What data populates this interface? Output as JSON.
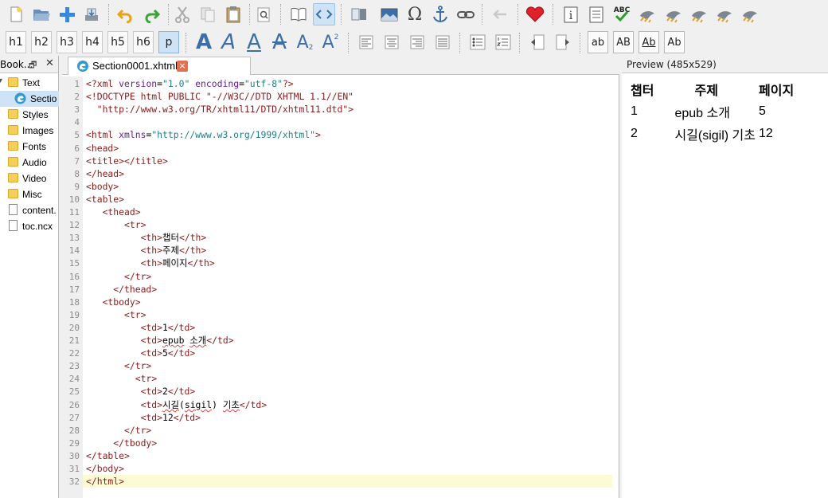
{
  "toolbar_row1": {
    "icons": [
      "new-file-icon",
      "open-folder-icon",
      "add-file-icon",
      "save-icon",
      "undo-icon",
      "redo-icon",
      "cut-icon",
      "copy-icon",
      "paste-icon",
      "find-icon",
      "book-view-icon",
      "code-view-icon",
      "split-view-icon",
      "insert-image-icon",
      "special-char-icon",
      "anchor-icon",
      "link-icon",
      "back-icon",
      "validate-icon",
      "metadata-icon",
      "toc-icon",
      "spellcheck-icon",
      "plugin-1-icon",
      "plugin-2-icon",
      "plugin-3-icon",
      "plugin-4-icon",
      "plugin-5-icon"
    ]
  },
  "toolbar_row2": {
    "headings": [
      "h1",
      "h2",
      "h3",
      "h4",
      "h5",
      "h6",
      "p"
    ],
    "active_heading": "p",
    "case_buttons": [
      "ab",
      "AB",
      "Ab",
      "Ab"
    ]
  },
  "book_browser": {
    "title": "Book...",
    "float_glyph": "🗗",
    "close_glyph": "✕",
    "items": [
      {
        "label": "Text",
        "kind": "folder"
      },
      {
        "label": "Sectio",
        "kind": "edge"
      },
      {
        "label": "Styles",
        "kind": "folder"
      },
      {
        "label": "Images",
        "kind": "folder"
      },
      {
        "label": "Fonts",
        "kind": "folder"
      },
      {
        "label": "Audio",
        "kind": "folder"
      },
      {
        "label": "Video",
        "kind": "folder"
      },
      {
        "label": "Misc",
        "kind": "folder"
      },
      {
        "label": "content.",
        "kind": "file"
      },
      {
        "label": "toc.ncx",
        "kind": "file"
      }
    ]
  },
  "editor": {
    "tab_label": "Section0001.xhtml",
    "tab_close": "×",
    "current_line": 32,
    "lines": [
      [
        [
          "pi",
          "<?xml "
        ],
        [
          "at",
          "version"
        ],
        [
          "tx",
          "="
        ],
        [
          "st",
          "\"1.0\""
        ],
        [
          "tx",
          " "
        ],
        [
          "at",
          "encoding"
        ],
        [
          "tx",
          "="
        ],
        [
          "st",
          "\"utf-8\""
        ],
        [
          "pi",
          "?>"
        ]
      ],
      [
        [
          "tg",
          "<!DOCTYPE html PUBLIC \"-//W3C//DTD XHTML 1.1//EN\""
        ]
      ],
      [
        [
          "tg",
          "  \"http://www.w3.org/TR/xhtml11/DTD/xhtml11.dtd\">"
        ]
      ],
      [],
      [
        [
          "tg",
          "<html "
        ],
        [
          "at",
          "xmlns"
        ],
        [
          "tx",
          "="
        ],
        [
          "st",
          "\"http://www.w3.org/1999/xhtml\""
        ],
        [
          "tg",
          ">"
        ]
      ],
      [
        [
          "tg",
          "<head>"
        ]
      ],
      [
        [
          "tg",
          "<title></title>"
        ]
      ],
      [
        [
          "tg",
          "</head>"
        ]
      ],
      [
        [
          "tg",
          "<body>"
        ]
      ],
      [
        [
          "tg",
          "<table>"
        ]
      ],
      [
        [
          "tg",
          "   <thead>"
        ]
      ],
      [
        [
          "tg",
          "       <tr>"
        ]
      ],
      [
        [
          "tg",
          "          <th>"
        ],
        [
          "tx",
          "챕터"
        ],
        [
          "tg",
          "</th>"
        ]
      ],
      [
        [
          "tg",
          "          <th>"
        ],
        [
          "tx",
          "주제"
        ],
        [
          "tg",
          "</th>"
        ]
      ],
      [
        [
          "tg",
          "          <th>"
        ],
        [
          "tx",
          "페이지"
        ],
        [
          "tg",
          "</th>"
        ]
      ],
      [
        [
          "tg",
          "       </tr>"
        ]
      ],
      [
        [
          "tg",
          "     </thead>"
        ]
      ],
      [
        [
          "tg",
          "   <tbody>"
        ]
      ],
      [
        [
          "tg",
          "       <tr>"
        ]
      ],
      [
        [
          "tg",
          "          <td>"
        ],
        [
          "tx",
          "1"
        ],
        [
          "tg",
          "</td>"
        ]
      ],
      [
        [
          "tg",
          "          <td>"
        ],
        [
          "sq",
          "epub"
        ],
        [
          "tx",
          " "
        ],
        [
          "sq",
          "소개"
        ],
        [
          "tg",
          "</td>"
        ]
      ],
      [
        [
          "tg",
          "          <td>"
        ],
        [
          "tx",
          "5"
        ],
        [
          "tg",
          "</td>"
        ]
      ],
      [
        [
          "tg",
          "       </tr>"
        ]
      ],
      [
        [
          "tg",
          "         <tr>"
        ]
      ],
      [
        [
          "tg",
          "          <td>"
        ],
        [
          "tx",
          "2"
        ],
        [
          "tg",
          "</td>"
        ]
      ],
      [
        [
          "tg",
          "          <td>"
        ],
        [
          "sq",
          "시길"
        ],
        [
          "tx",
          "("
        ],
        [
          "sq",
          "sigil"
        ],
        [
          "tx",
          ") "
        ],
        [
          "sq",
          "기초"
        ],
        [
          "tg",
          "</td>"
        ]
      ],
      [
        [
          "tg",
          "          <td>"
        ],
        [
          "tx",
          "12"
        ],
        [
          "tg",
          "</td>"
        ]
      ],
      [
        [
          "tg",
          "       </tr>"
        ]
      ],
      [
        [
          "tg",
          "     </tbody>"
        ]
      ],
      [
        [
          "tg",
          "</table>"
        ]
      ],
      [
        [
          "tg",
          "</body>"
        ]
      ],
      [
        [
          "tg",
          "</html>"
        ]
      ]
    ]
  },
  "preview": {
    "title": "Preview (485x529)",
    "headers": [
      "챕터",
      "주제",
      "페이지"
    ],
    "rows": [
      [
        "1",
        "epub 소개",
        "5"
      ],
      [
        "2",
        "시길(sigil) 기초",
        "12"
      ]
    ]
  },
  "colors": {
    "accent": "#cfe3f7",
    "current_line": "#fdfbd3",
    "tab_close": "#e0704f",
    "folder": "#f6cf5b"
  }
}
